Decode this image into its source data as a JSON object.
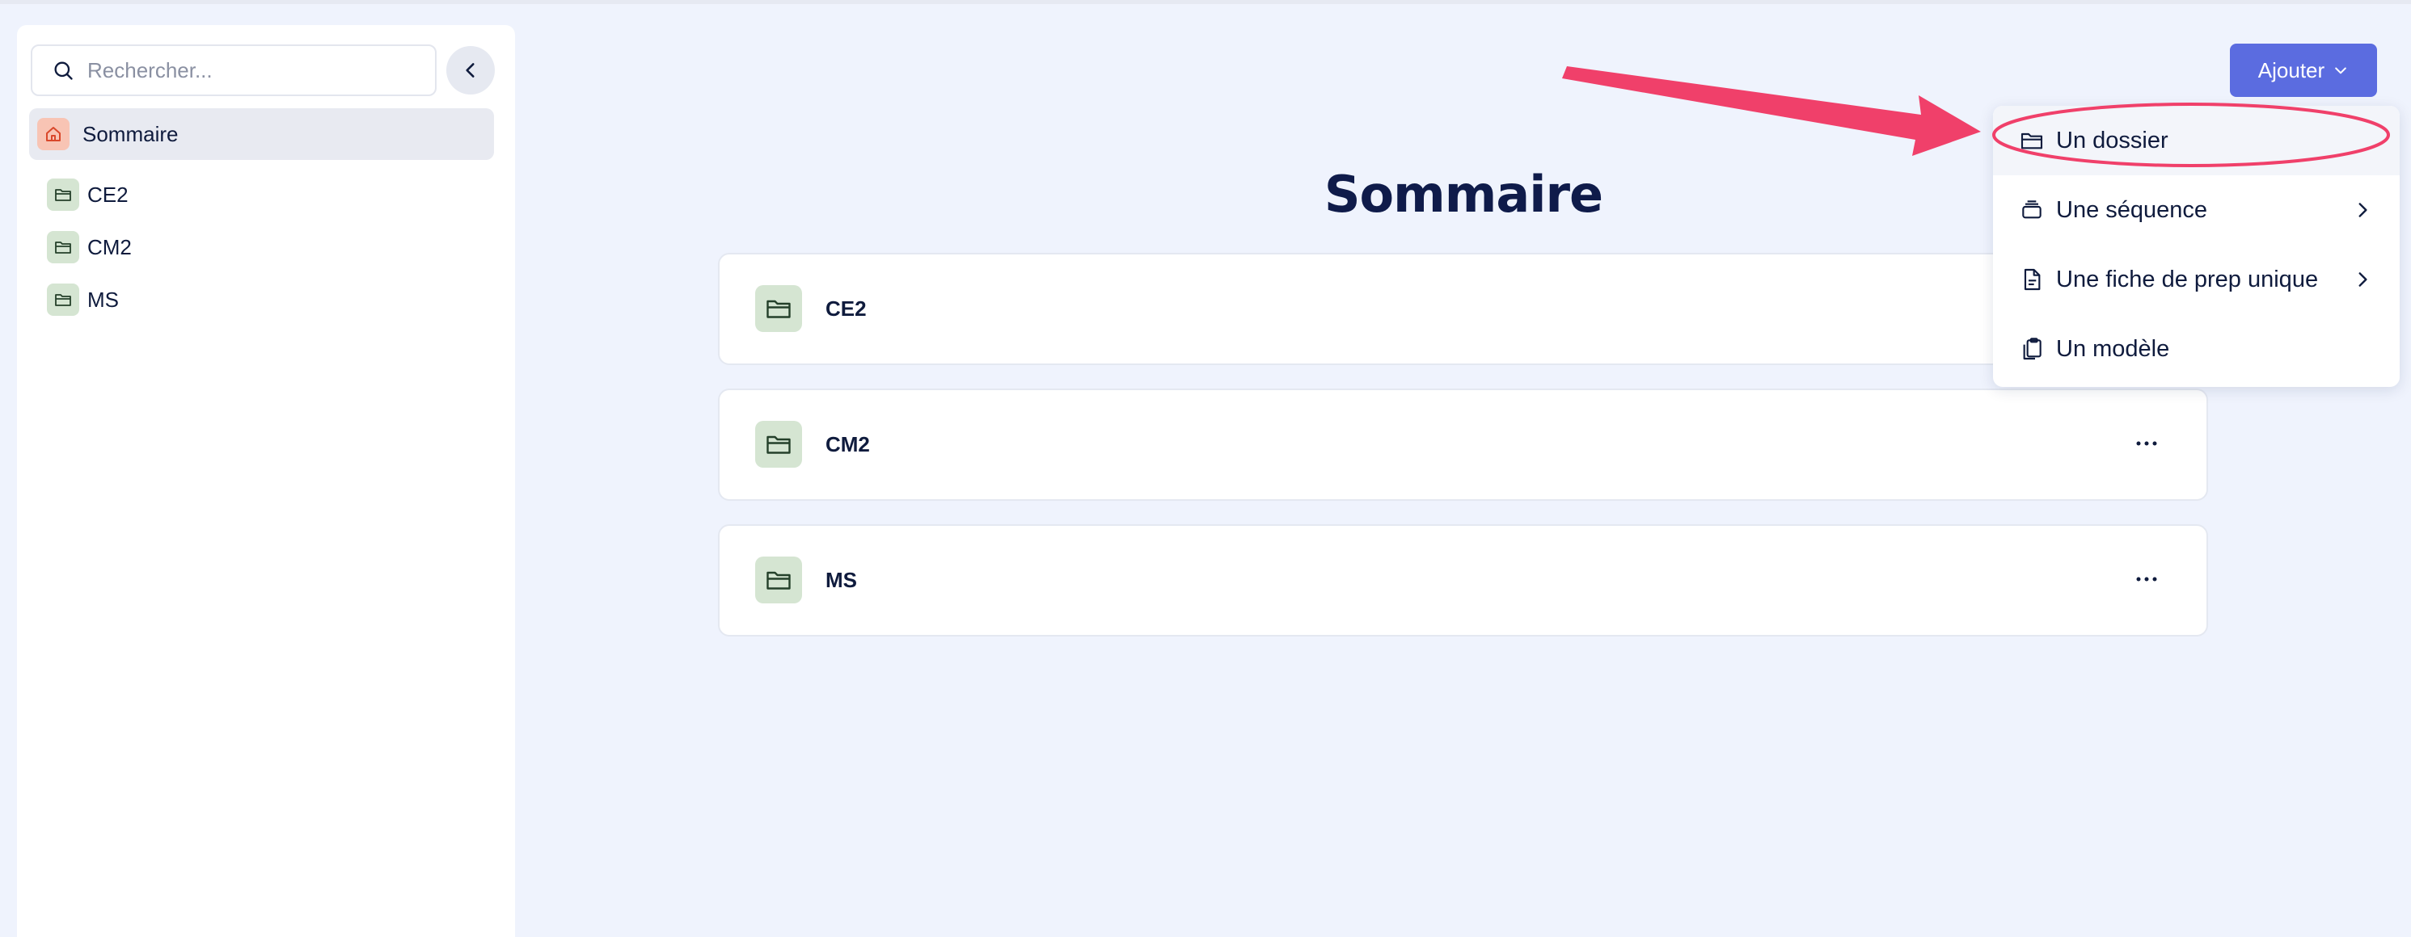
{
  "sidebar": {
    "search": {
      "placeholder": "Rechercher...",
      "value": ""
    },
    "home": {
      "label": "Sommaire"
    },
    "items": [
      {
        "label": "CE2"
      },
      {
        "label": "CM2"
      },
      {
        "label": "MS"
      }
    ]
  },
  "main": {
    "title": "Sommaire",
    "cards": [
      {
        "label": "CE2"
      },
      {
        "label": "CM2"
      },
      {
        "label": "MS"
      }
    ]
  },
  "header": {
    "add_button_label": "Ajouter"
  },
  "dropdown": {
    "items": [
      {
        "label": "Un dossier",
        "icon": "folder-icon",
        "has_submenu": false
      },
      {
        "label": "Une séquence",
        "icon": "stack-icon",
        "has_submenu": true
      },
      {
        "label": "Une fiche de prep unique",
        "icon": "document-icon",
        "has_submenu": true
      },
      {
        "label": "Un modèle",
        "icon": "clipboard-copy-icon",
        "has_submenu": false
      }
    ]
  },
  "colors": {
    "background": "#eff3fd",
    "accent": "#5b6ce0",
    "annotation": "#f0406a",
    "folder_badge": "#d5e5d2",
    "home_badge": "#f8c4b4"
  }
}
